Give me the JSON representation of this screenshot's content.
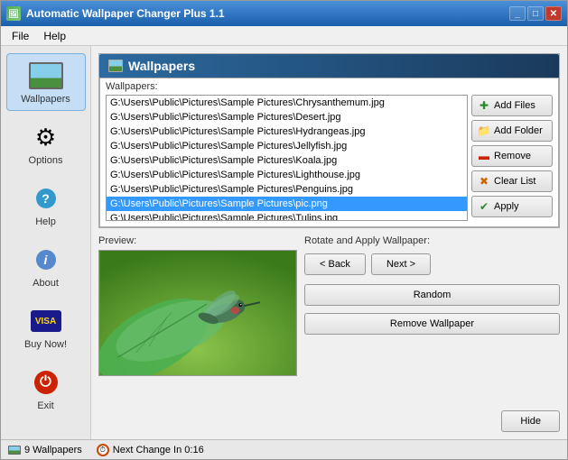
{
  "window": {
    "title": "Automatic Wallpaper Changer Plus 1.1",
    "title_icon": "🖼"
  },
  "menu": {
    "items": [
      "File",
      "Help"
    ]
  },
  "sidebar": {
    "items": [
      {
        "id": "wallpapers",
        "label": "Wallpapers",
        "active": true
      },
      {
        "id": "options",
        "label": "Options"
      },
      {
        "id": "help",
        "label": "Help"
      },
      {
        "id": "about",
        "label": "About"
      },
      {
        "id": "buynow",
        "label": "Buy Now!"
      },
      {
        "id": "exit",
        "label": "Exit"
      }
    ]
  },
  "section": {
    "title": "Wallpapers",
    "wallpapers_label": "Wallpapers:"
  },
  "file_list": {
    "items": [
      "G:\\Users\\Public\\Pictures\\Sample Pictures\\Chrysanthemum.jpg",
      "G:\\Users\\Public\\Pictures\\Sample Pictures\\Desert.jpg",
      "G:\\Users\\Public\\Pictures\\Sample Pictures\\Hydrangeas.jpg",
      "G:\\Users\\Public\\Pictures\\Sample Pictures\\Jellyfish.jpg",
      "G:\\Users\\Public\\Pictures\\Sample Pictures\\Koala.jpg",
      "G:\\Users\\Public\\Pictures\\Sample Pictures\\Lighthouse.jpg",
      "G:\\Users\\Public\\Pictures\\Sample Pictures\\Penguins.jpg",
      "G:\\Users\\Public\\Pictures\\Sample Pictures\\pic.png",
      "G:\\Users\\Public\\Pictures\\Sample Pictures\\Tulips.jpg"
    ],
    "selected_index": 7
  },
  "action_buttons": [
    {
      "id": "add-files",
      "label": "Add Files",
      "icon": "+"
    },
    {
      "id": "add-folder",
      "label": "Add Folder",
      "icon": "📁"
    },
    {
      "id": "remove",
      "label": "Remove",
      "icon": "—"
    },
    {
      "id": "clear-list",
      "label": "Clear List",
      "icon": "✕"
    },
    {
      "id": "apply",
      "label": "Apply",
      "icon": "✓"
    }
  ],
  "preview": {
    "label": "Preview:"
  },
  "rotate": {
    "label": "Rotate and Apply Wallpaper:",
    "back_btn": "< Back",
    "next_btn": "Next >",
    "random_btn": "Random",
    "remove_wallpaper_btn": "Remove Wallpaper",
    "hide_btn": "Hide"
  },
  "status": {
    "wallpaper_count": "9 Wallpapers",
    "next_change": "Next Change In 0:16"
  }
}
